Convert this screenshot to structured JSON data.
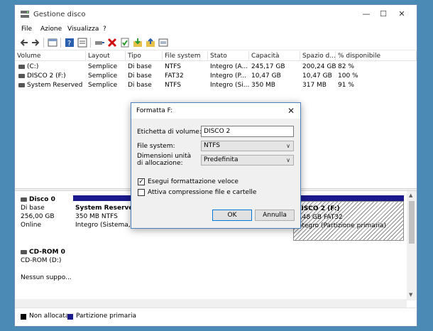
{
  "window": {
    "title": "Gestione disco",
    "menu": [
      "File",
      "Azione",
      "Visualizza",
      "?"
    ]
  },
  "toolbar": {
    "icons": [
      "back-arrow-icon",
      "forward-arrow-icon",
      "properties-icon",
      "help-icon",
      "list-view-icon",
      "connect-icon",
      "delete-icon",
      "check-icon",
      "import-icon",
      "export-icon",
      "console-icon"
    ]
  },
  "volumes": {
    "headers": [
      "Volume",
      "Layout",
      "Tipo",
      "File system",
      "Stato",
      "Capacità",
      "Spazio d...",
      "% disponibile"
    ],
    "rows": [
      [
        "(C:)",
        "Semplice",
        "Di base",
        "NTFS",
        "Integro (A...",
        "245,17 GB",
        "200,24 GB",
        "82 %"
      ],
      [
        "DISCO 2 (F:)",
        "Semplice",
        "Di base",
        "FAT32",
        "Integro (P...",
        "10,47 GB",
        "10,47 GB",
        "100 %"
      ],
      [
        "System Reserved",
        "Semplice",
        "Di base",
        "NTFS",
        "Integro (Si...",
        "350 MB",
        "317 MB",
        "91 %"
      ]
    ]
  },
  "disks": {
    "disk0": {
      "name": "Disco 0",
      "type": "Di base",
      "size": "256,00 GB",
      "status": "Online",
      "partitions": [
        {
          "title": "System Reserved",
          "size": "350 MB NTFS",
          "status": "Integro (Sistema, At"
        },
        {
          "title": "DISCO 2  (F:)",
          "size": "0,48 GB FAT32",
          "status": "Integro (Partizione primaria)"
        }
      ]
    },
    "cdrom": {
      "name": "CD-ROM 0",
      "type": "CD-ROM (D:)",
      "status": "Nessun suppo..."
    }
  },
  "legend": {
    "unallocated": "Non allocata",
    "primary": "Partizione primaria",
    "unallocated_color": "#000000",
    "primary_color": "#1a1a8c"
  },
  "dialog": {
    "title": "Formatta F:",
    "volume_label_label": "Etichetta di volume:",
    "volume_label_value": "DISCO 2",
    "fs_label": "File system:",
    "fs_value": "NTFS",
    "alloc_label": "Dimensioni unità di allocazione:",
    "alloc_value": "Predefinita",
    "quick_format_label": "Esegui formattazione veloce",
    "quick_format_checked": true,
    "compression_label": "Attiva compressione file e cartelle",
    "compression_checked": false,
    "ok_label": "OK",
    "cancel_label": "Annulla"
  }
}
